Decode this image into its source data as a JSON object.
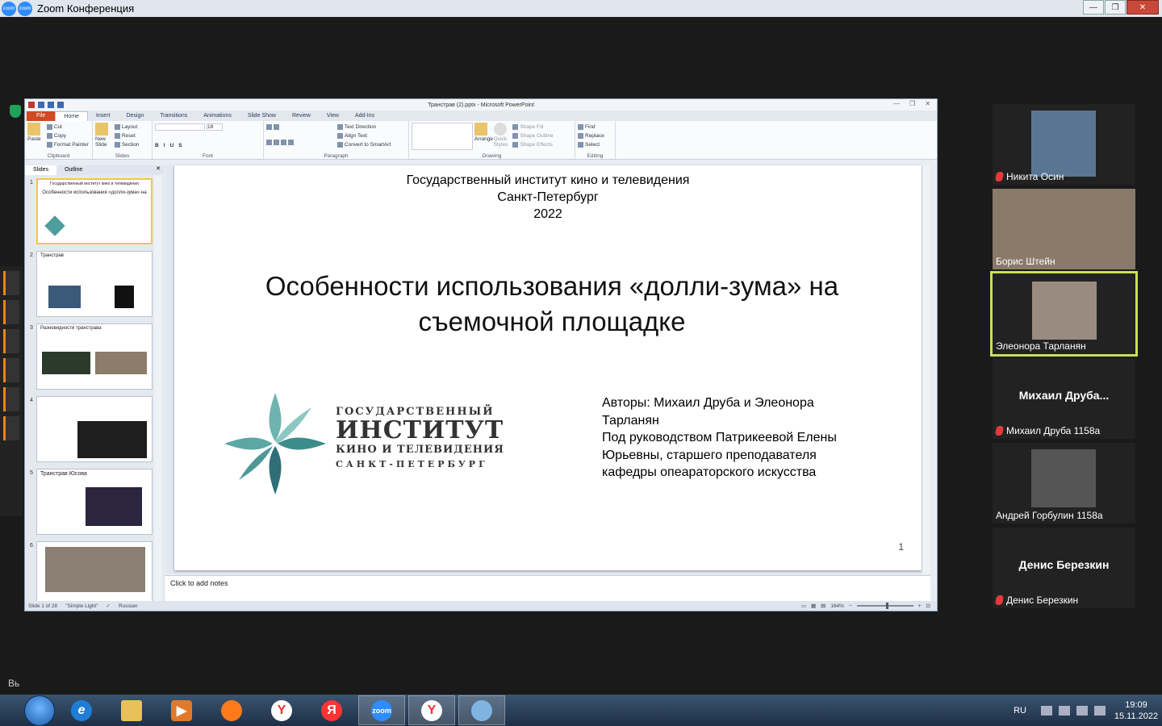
{
  "zoom": {
    "title": "Zoom Конференция",
    "icon_label": "zoom"
  },
  "ppt": {
    "title": "Транстрав (2).pptx - Microsoft PowerPoint",
    "tabs": [
      "File",
      "Home",
      "Insert",
      "Design",
      "Transitions",
      "Animations",
      "Slide Show",
      "Review",
      "View",
      "Add-Ins"
    ],
    "ribbon": {
      "clipboard": {
        "paste": "Paste",
        "cut": "Cut",
        "copy": "Copy",
        "format_painter": "Format Painter",
        "label": "Clipboard"
      },
      "slides": {
        "new_slide": "New Slide",
        "layout": "Layout",
        "reset": "Reset",
        "section": "Section",
        "label": "Slides"
      },
      "font": {
        "size": "18",
        "label": "Font"
      },
      "paragraph": {
        "text_direction": "Text Direction",
        "align_text": "Align Text",
        "convert": "Convert to SmartArt",
        "label": "Paragraph"
      },
      "drawing": {
        "arrange": "Arrange",
        "quick_styles": "Quick Styles",
        "shape_fill": "Shape Fill",
        "shape_outline": "Shape Outline",
        "shape_effects": "Shape Effects",
        "label": "Drawing"
      },
      "editing": {
        "find": "Find",
        "replace": "Replace",
        "select": "Select",
        "label": "Editing"
      }
    },
    "panel_tabs": [
      "Slides",
      "Outline"
    ],
    "thumbnails": [
      {
        "num": "1",
        "title": ""
      },
      {
        "num": "2",
        "title": "Транстрав"
      },
      {
        "num": "3",
        "title": "Разновидности транстрава"
      },
      {
        "num": "4",
        "title": ""
      },
      {
        "num": "5",
        "title": "Транстрав Юсова"
      },
      {
        "num": "6",
        "title": ""
      }
    ],
    "slide": {
      "institute": "Государственный институт кино и телевидения",
      "city": "Санкт-Петербург",
      "year": "2022",
      "title_line1": "Особенности использования «долли-зума» на",
      "title_line2": "съемочной площадке",
      "authors_line1": "Авторы: Михаил Друба и Элеонора",
      "authors_line2": "Тарланян",
      "authors_line3": "Под руководством Патрикеевой Елены",
      "authors_line4": "Юрьевны, старшего преподавателя",
      "authors_line5": "кафедры опеараторского искусства",
      "page_number": "1",
      "logo_l1": "ГОСУДАРСТВЕННЫЙ",
      "logo_l2": "ИНСТИТУТ",
      "logo_l3": "КИНО И ТЕЛЕВИДЕНИЯ",
      "logo_l4": "САНКТ-ПЕТЕРБУРГ"
    },
    "notes_placeholder": "Click to add notes",
    "status": {
      "slide": "Slide 1 of 28",
      "theme": "\"Simple Light\"",
      "language": "Russian",
      "zoom": "164%"
    }
  },
  "participants": [
    {
      "name": "Никита Осин",
      "muted": true,
      "video": true
    },
    {
      "name": "Борис Штейн",
      "muted": false,
      "video": true
    },
    {
      "name": "Элеонора Тарланян",
      "muted": false,
      "video": true,
      "speaking": true
    },
    {
      "display": "Михаил  Друба...",
      "name": "Михаил Друба 1158а",
      "muted": true,
      "video": false
    },
    {
      "name": "Андрей Горбулин 1158а",
      "muted": false,
      "video": true
    },
    {
      "display": "Денис Березкин",
      "name": "Денис Березкин",
      "muted": true,
      "video": false
    }
  ],
  "side_text": "Вь",
  "taskbar": {
    "language": "RU",
    "time": "19:09",
    "date": "15.11.2022",
    "zoom_label": "zoom",
    "yandex_label": "Я",
    "y_label": "Y"
  }
}
